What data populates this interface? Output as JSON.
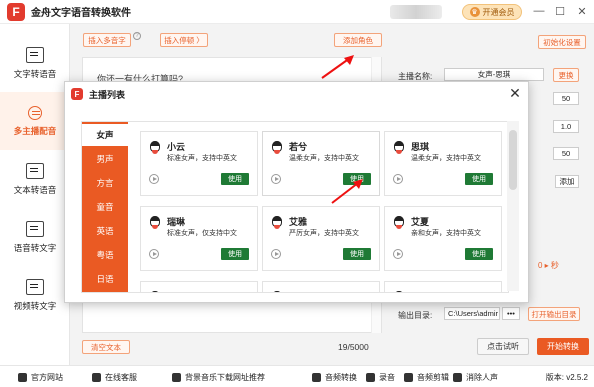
{
  "app": {
    "title": "金舟文字语音转换软件",
    "logo_char": "F",
    "vip_label": "开通会员",
    "vip_icon": "crown-icon"
  },
  "window": {
    "minimize": "—",
    "maximize": "☐",
    "close": "✕"
  },
  "sidebar": {
    "items": [
      {
        "label": "文字转语音",
        "icon": "text-to-speech-icon"
      },
      {
        "label": "多主播配音",
        "icon": "multi-anchor-icon",
        "active": true
      },
      {
        "label": "文本转语音",
        "icon": "document-to-speech-icon"
      },
      {
        "label": "语音转文字",
        "icon": "speech-to-text-icon"
      },
      {
        "label": "视频转文字",
        "icon": "video-to-text-icon"
      }
    ]
  },
  "toolbar": {
    "insert_polyphone": "插入多音字",
    "insert_pause": "插入停顿 〉",
    "add_role": "添加角色",
    "help": "?"
  },
  "editor": {
    "text": "你还一有什么打算吗?"
  },
  "right_panel": {
    "init_settings": "初始化设置",
    "anchor_label": "主播名称:",
    "anchor_value": "女声-思琪",
    "change_label": "更换",
    "value1": "50",
    "value2": "1.0",
    "value3": "50",
    "add_label": "添加",
    "seconds_suffix": "0 ▸ 秒",
    "output_label": "输出目录:",
    "output_path": "C:\\Users\\admir",
    "more": "•••",
    "open_dir": "打开输出目录"
  },
  "bottom": {
    "clear": "清空文本",
    "counter": "19/5000",
    "trial": "点击试听",
    "start": "开始转换"
  },
  "footer": {
    "items": [
      {
        "label": "官方网站",
        "icon": "home-icon"
      },
      {
        "label": "在线客服",
        "icon": "chat-icon"
      },
      {
        "label": "背景音乐下载网址推荐",
        "icon": "music-icon"
      },
      {
        "label": "音频转换",
        "icon": "audio-convert-icon"
      },
      {
        "label": "录音",
        "icon": "mic-icon"
      },
      {
        "label": "音频剪辑",
        "icon": "audio-cut-icon"
      },
      {
        "label": "消除人声",
        "icon": "vocal-remove-icon"
      }
    ],
    "version": "版本: v2.5.2"
  },
  "modal": {
    "title": "主播列表",
    "close": "✕",
    "languages": [
      "女声",
      "男声",
      "方言",
      "童音",
      "英语",
      "粤语",
      "日语"
    ],
    "active_language": "女声",
    "cards": [
      {
        "name": "小云",
        "desc": "标准女声，支持中英文",
        "use": "使用"
      },
      {
        "name": "若兮",
        "desc": "温柔女声，支持中英文",
        "use": "使用"
      },
      {
        "name": "思琪",
        "desc": "温柔女声，支持中英文",
        "use": "使用"
      },
      {
        "name": "瑞琳",
        "desc": "标准女声，仅支持中文",
        "use": "使用"
      },
      {
        "name": "艾雅",
        "desc": "严厉女声，支持中英文",
        "use": "使用"
      },
      {
        "name": "艾夏",
        "desc": "亲和女声，支持中英文",
        "use": "使用"
      }
    ]
  },
  "colors": {
    "accent": "#ea5a23",
    "use_button": "#1f7a35",
    "logo": "#e23b2e",
    "vip_bg": "#fde3b8"
  }
}
